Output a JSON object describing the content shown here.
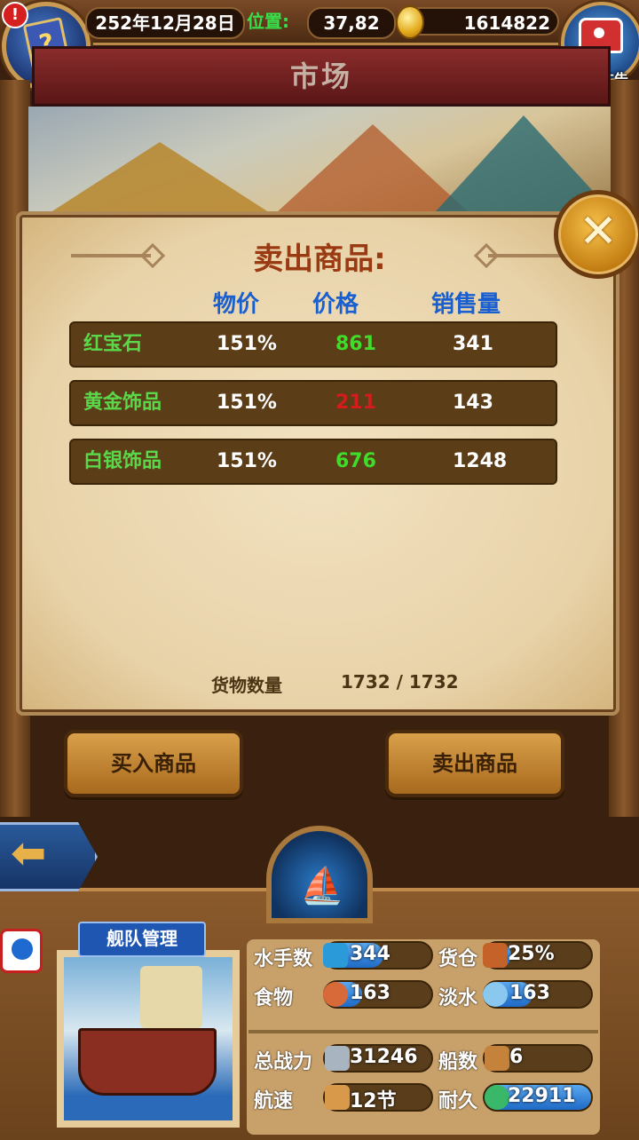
{
  "top": {
    "date": "252年12月28日",
    "position_label": "位置:",
    "position_value": "37,82",
    "gold": "1614822",
    "ad_label": "有新广告",
    "alert_mark": "!"
  },
  "market": {
    "title": "市场",
    "panel_title": "卖出商品:",
    "columns": [
      "物价",
      "价格",
      "销售量"
    ],
    "rows": [
      {
        "name": "红宝石",
        "ratio": "151%",
        "price": "861",
        "volume": "341",
        "price_color": "#3fdc2a"
      },
      {
        "name": "黄金饰品",
        "ratio": "151%",
        "price": "211",
        "volume": "143",
        "price_color": "#d41c1c"
      },
      {
        "name": "白银饰品",
        "ratio": "151%",
        "price": "676",
        "volume": "1248",
        "price_color": "#3fdc2a"
      }
    ],
    "cargo_label": "货物数量",
    "cargo_value": "1732 / 1732",
    "close_glyph": "✕"
  },
  "actions": {
    "buy_label": "买入商品",
    "sell_label": "卖出商品",
    "back_glyph": "⬅"
  },
  "fleet": {
    "tag": "舰队管理",
    "stats": {
      "sailors_label": "水手数",
      "sailors_value": "344",
      "cargo_label": "货仓",
      "cargo_value": "25%",
      "food_label": "食物",
      "food_value": "163",
      "water_label": "淡水",
      "water_value": "163",
      "power_label": "总战力",
      "power_value": "31246",
      "ships_label": "船数",
      "ships_value": "6",
      "speed_label": "航速",
      "speed_value": "12节",
      "durability_label": "耐久",
      "durability_value": "22911"
    },
    "levels": {
      "sailors": 0.55,
      "cargo": 0.25,
      "food": 0.35,
      "water": 0.45,
      "durability": 1.0
    }
  },
  "colors": {
    "accent_blue": "#1a5fcf",
    "title_red": "#9a3a12",
    "item_green": "#5bd84a"
  },
  "icons": [
    "book-icon",
    "coin-icon",
    "treasure-chest-icon",
    "close-icon",
    "back-arrow-icon",
    "ship-icon",
    "sailor-icon",
    "cargo-icon",
    "food-icon",
    "water-icon",
    "power-icon",
    "ships-icon",
    "speed-icon",
    "durability-icon"
  ]
}
